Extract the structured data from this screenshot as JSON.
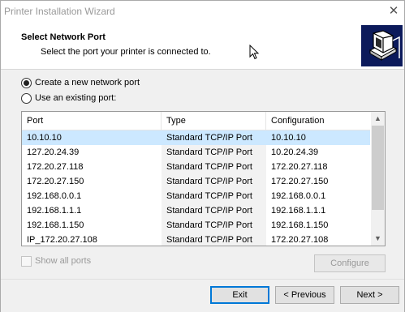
{
  "window": {
    "title": "Printer Installation Wizard",
    "close_glyph": "✕"
  },
  "header": {
    "title": "Select Network Port",
    "subtitle": "Select the port your printer is connected to.",
    "icon": "printer-network-icon"
  },
  "options": {
    "create_new": {
      "label": "Create a new network port",
      "checked": true
    },
    "use_existing": {
      "label": "Use an existing port:",
      "checked": false
    }
  },
  "ports": {
    "columns": [
      "Port",
      "Type",
      "Configuration"
    ],
    "rows": [
      {
        "port": "10.10.10",
        "type": "Standard TCP/IP Port",
        "config": "10.10.10",
        "selected": true
      },
      {
        "port": "127.20.24.39",
        "type": "Standard TCP/IP Port",
        "config": "10.20.24.39"
      },
      {
        "port": "172.20.27.118",
        "type": "Standard TCP/IP Port",
        "config": "172.20.27.118"
      },
      {
        "port": "172.20.27.150",
        "type": "Standard TCP/IP Port",
        "config": "172.20.27.150"
      },
      {
        "port": "192.168.0.0.1",
        "type": "Standard TCP/IP Port",
        "config": "192.168.0.0.1"
      },
      {
        "port": "192.168.1.1.1",
        "type": "Standard TCP/IP Port",
        "config": "192.168.1.1.1"
      },
      {
        "port": "192.168.1.150",
        "type": "Standard TCP/IP Port",
        "config": "192.168.1.150"
      },
      {
        "port": "IP_172.20.27.108",
        "type": "Standard TCP/IP Port",
        "config": "172.20.27.108"
      }
    ],
    "scroll_up_glyph": "▲",
    "scroll_down_glyph": "▼"
  },
  "show_all": {
    "label": "Show all ports",
    "enabled": false
  },
  "buttons": {
    "configure": "Configure",
    "exit": "Exit",
    "previous": "< Previous",
    "next": "Next >"
  },
  "colors": {
    "selection": "#cce8ff",
    "icon_bg": "#0c1a5b",
    "default_button_border": "#0078d7"
  }
}
